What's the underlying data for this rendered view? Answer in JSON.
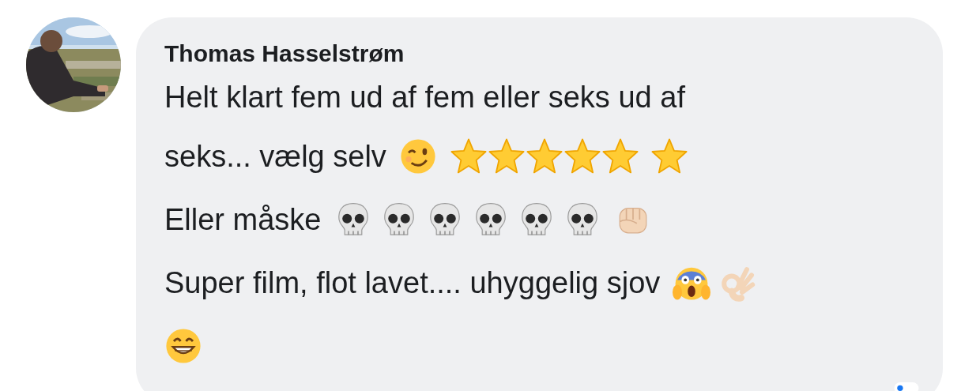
{
  "comment": {
    "author": "Thomas Hasselstrøm",
    "lines": [
      [
        {
          "kind": "text",
          "text": "Helt klart fem ud af fem eller seks ud af"
        }
      ],
      [
        {
          "kind": "text",
          "text": "seks... vælg selv"
        },
        {
          "kind": "wink"
        },
        {
          "kind": "star"
        },
        {
          "kind": "star"
        },
        {
          "kind": "star"
        },
        {
          "kind": "star"
        },
        {
          "kind": "star"
        },
        {
          "kind": "star"
        }
      ],
      [
        {
          "kind": "text",
          "text": "Eller måske"
        },
        {
          "kind": "skull"
        },
        {
          "kind": "skull"
        },
        {
          "kind": "skull"
        },
        {
          "kind": "skull"
        },
        {
          "kind": "skull"
        },
        {
          "kind": "skull"
        },
        {
          "kind": "fist"
        }
      ],
      [
        {
          "kind": "text",
          "text": "Super film, flot lavet.... uhyggelig sjov"
        },
        {
          "kind": "scream"
        },
        {
          "kind": "ok-hand"
        }
      ],
      [
        {
          "kind": "grin"
        }
      ]
    ]
  }
}
